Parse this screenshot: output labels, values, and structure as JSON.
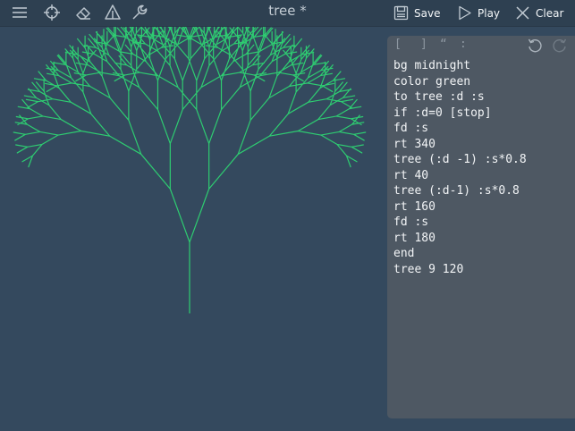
{
  "toolbar": {
    "icons": [
      "menu-icon",
      "crosshair-icon",
      "eraser-icon",
      "turtle-triangle-icon",
      "wrench-icon"
    ],
    "title": "tree *",
    "save_label": "Save",
    "play_label": "Play",
    "clear_label": "Clear"
  },
  "editor": {
    "symbols": [
      "[",
      "]",
      "“",
      ":"
    ],
    "undo_icon": "undo-icon",
    "redo_icon": "redo-icon",
    "code": [
      "bg midnight",
      "color green",
      "to tree :d :s",
      "if :d=0 [stop]",
      "fd :s",
      "rt 340",
      "tree (:d -1) :s*0.8",
      "rt 40",
      "tree (:d-1) :s*0.8",
      "rt 160",
      "fd :s",
      "rt 180",
      "end",
      "tree 9 120"
    ]
  },
  "colors": {
    "background": "#34495e",
    "toolbar": "#2e4051",
    "editor": "#4e5863",
    "pen": "#2ecc71"
  }
}
